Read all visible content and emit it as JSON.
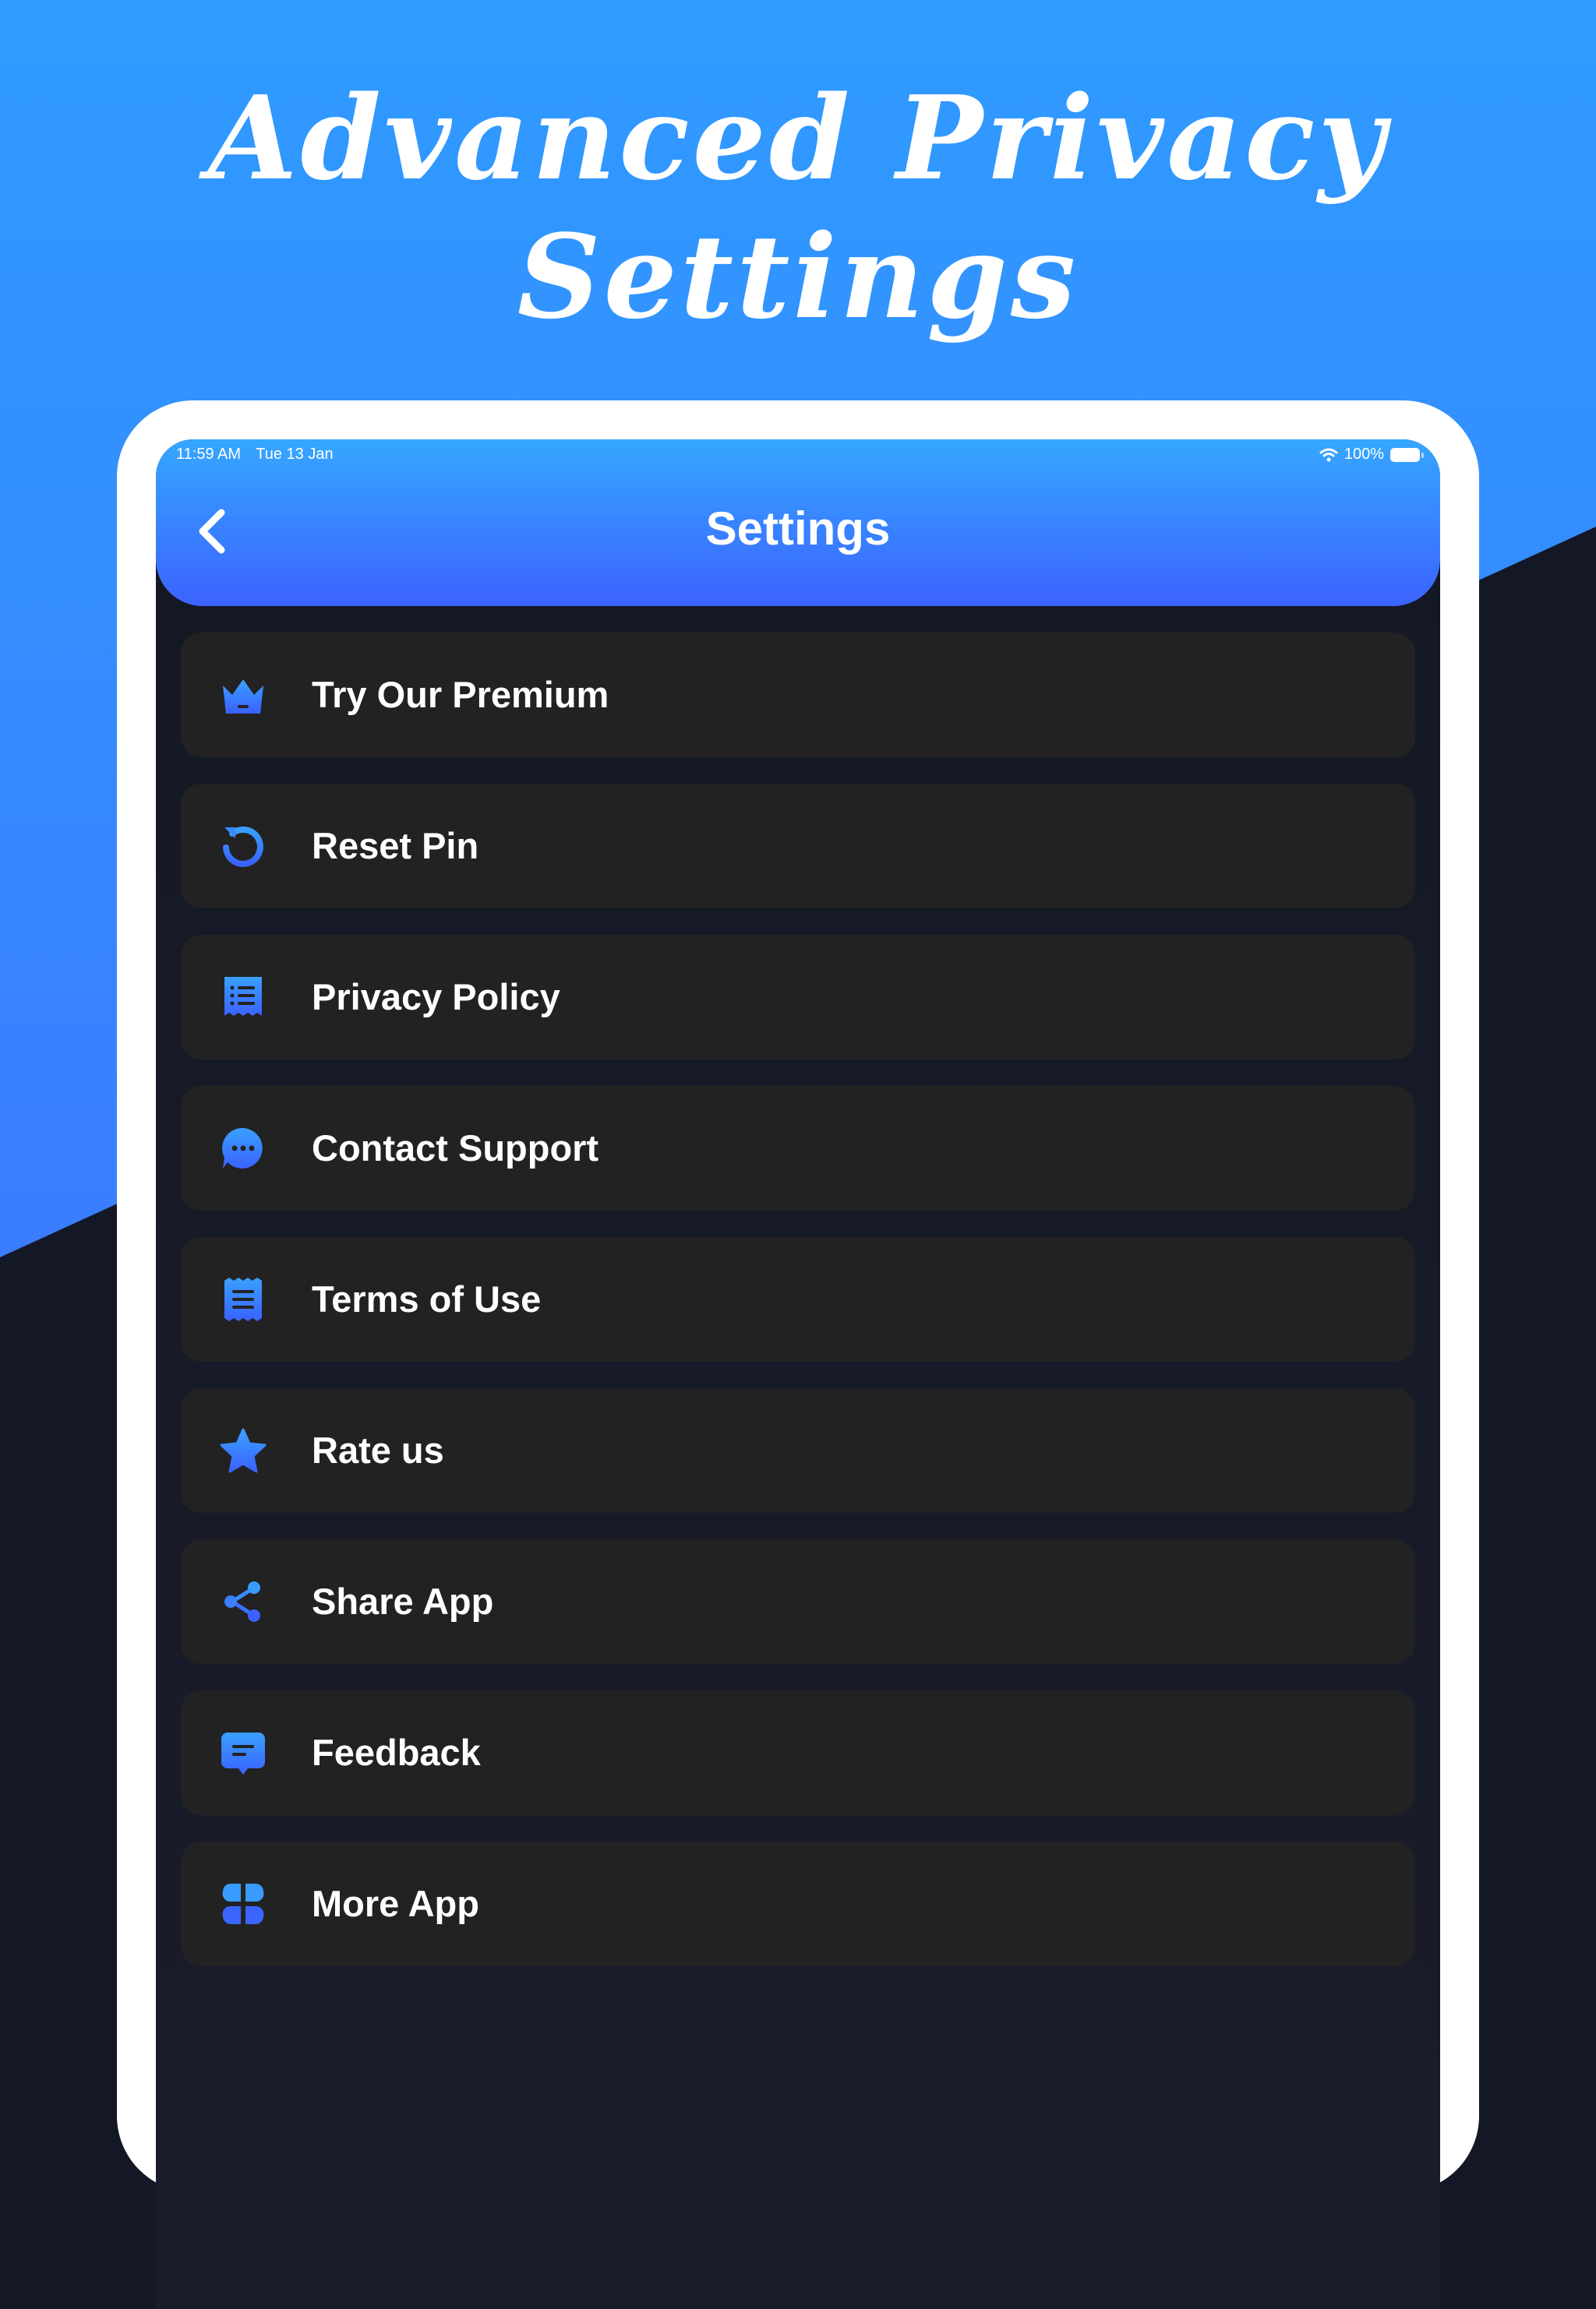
{
  "promo": {
    "title_line1": "Advanced Privacy",
    "title_line2": "Settings"
  },
  "status_bar": {
    "time": "11:59 AM",
    "date": "Tue 13 Jan",
    "battery": "100%"
  },
  "header": {
    "title": "Settings"
  },
  "menu": {
    "items": [
      {
        "label": "Try Our Premium",
        "icon": "crown-icon"
      },
      {
        "label": "Reset Pin",
        "icon": "reset-icon"
      },
      {
        "label": "Privacy Policy",
        "icon": "document-list-icon"
      },
      {
        "label": "Contact Support",
        "icon": "chat-bubble-icon"
      },
      {
        "label": "Terms of Use",
        "icon": "receipt-icon"
      },
      {
        "label": "Rate us",
        "icon": "star-icon"
      },
      {
        "label": "Share App",
        "icon": "share-icon"
      },
      {
        "label": "Feedback",
        "icon": "feedback-icon"
      },
      {
        "label": "More App",
        "icon": "apps-grid-icon"
      }
    ]
  },
  "colors": {
    "promo_bg": "#2f9bff",
    "dark_bg": "#141826",
    "header_top": "#35a7ff",
    "header_bottom": "#3c62ff",
    "card_bg": "#222222",
    "icon_accent": "#3a7bff",
    "text": "#ffffff"
  }
}
